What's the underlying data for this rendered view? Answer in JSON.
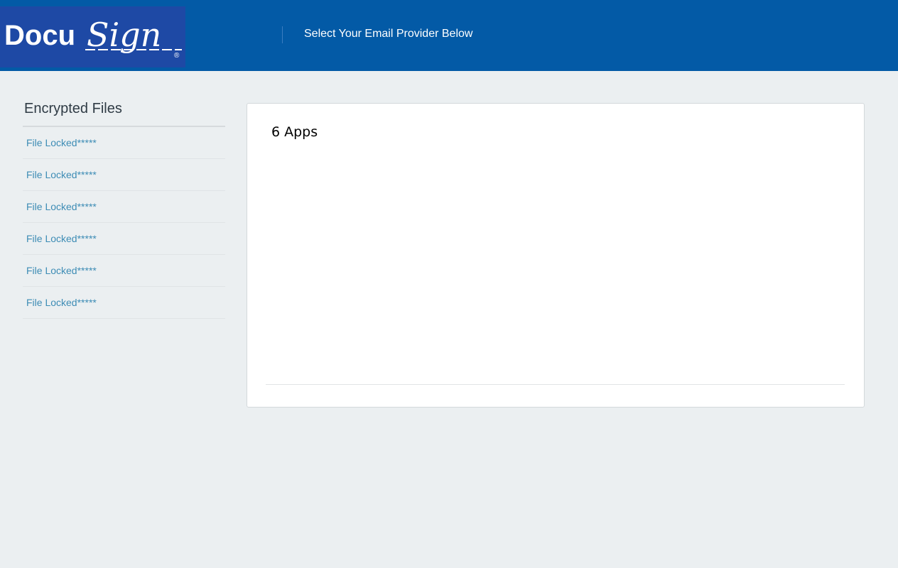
{
  "header": {
    "logo_text_part1": "Docu",
    "logo_text_part2": "Sign",
    "logo_mark": "®",
    "title": "Select Your Email Provider Below"
  },
  "sidebar": {
    "title": "Encrypted Files",
    "items": [
      {
        "label": "File Locked*****"
      },
      {
        "label": "File Locked*****"
      },
      {
        "label": "File Locked*****"
      },
      {
        "label": "File Locked*****"
      },
      {
        "label": "File Locked*****"
      },
      {
        "label": "File Locked*****"
      }
    ]
  },
  "main": {
    "panel_title": "6 Apps"
  },
  "colors": {
    "topbar": "#035aa6",
    "logo_bg": "#1e49a5",
    "page_bg": "#ebeff1",
    "link": "#3d8cb5"
  }
}
